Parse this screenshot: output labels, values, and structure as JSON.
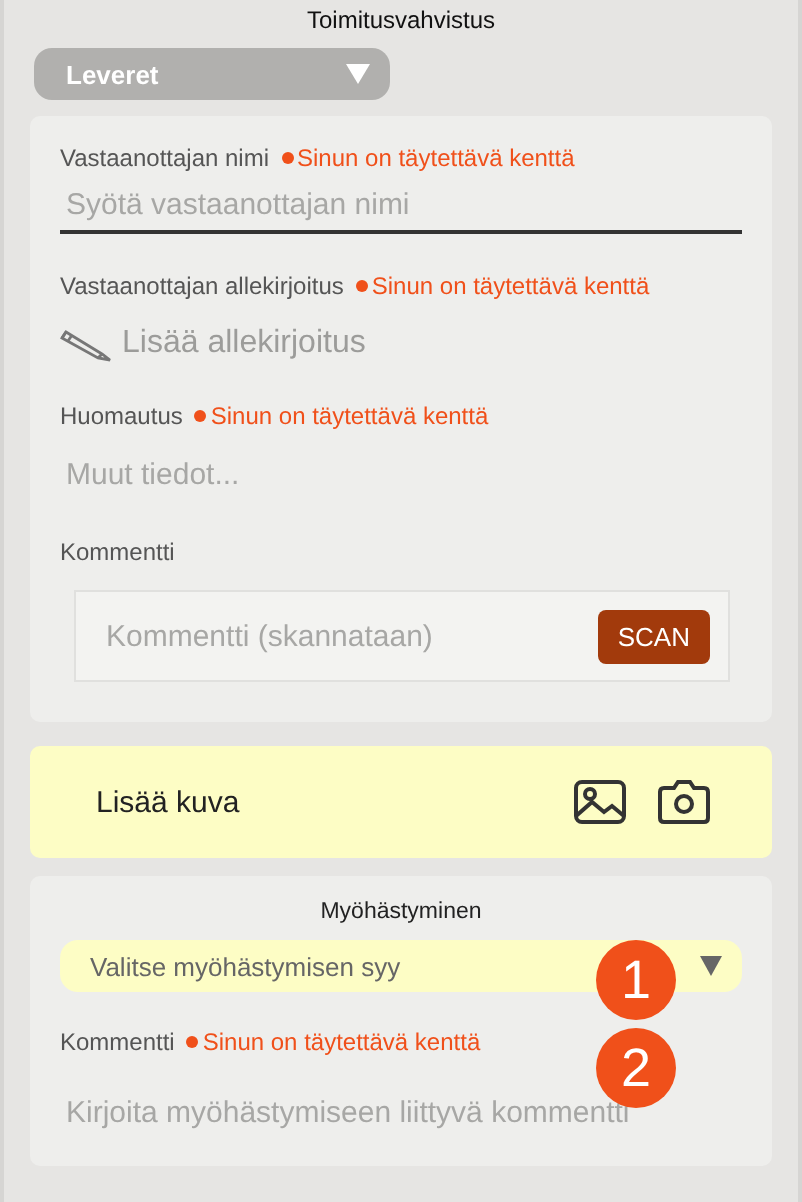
{
  "header": {
    "title": "Toimitusvahvistus"
  },
  "status_select": {
    "value": "Leveret"
  },
  "delivery_form": {
    "fields": [
      {
        "kind": "line-input",
        "label": "Vastaanottajan nimi",
        "required_note": "Sinun on täytettävä kenttä",
        "placeholder": "Syötä vastaanottajan nimi"
      },
      {
        "kind": "signature",
        "label": "Vastaanottajan allekirjoitus",
        "required_note": "Sinun on täytettävä kenttä",
        "action": "Lisää allekirjoitus"
      },
      {
        "kind": "plain-input",
        "label": "Huomautus",
        "required_note": "Sinun on täytettävä kenttä",
        "placeholder": "Muut tiedot..."
      },
      {
        "kind": "scan",
        "label": "Kommentti",
        "placeholder": "Kommentti (skannataan)",
        "button": "SCAN"
      }
    ]
  },
  "photo_bar": {
    "label": "Lisää kuva"
  },
  "delay_section": {
    "title": "Myöhästyminen",
    "select": {
      "placeholder": "Valitse myöhästymisen syy"
    },
    "comment": {
      "label": "Kommentti",
      "required_note": "Sinun on täytettävä kenttä",
      "placeholder": "Kirjoita myöhästymiseen liittyvä kommentti"
    }
  },
  "annotations": [
    {
      "label": "1"
    },
    {
      "label": "2"
    }
  ]
}
